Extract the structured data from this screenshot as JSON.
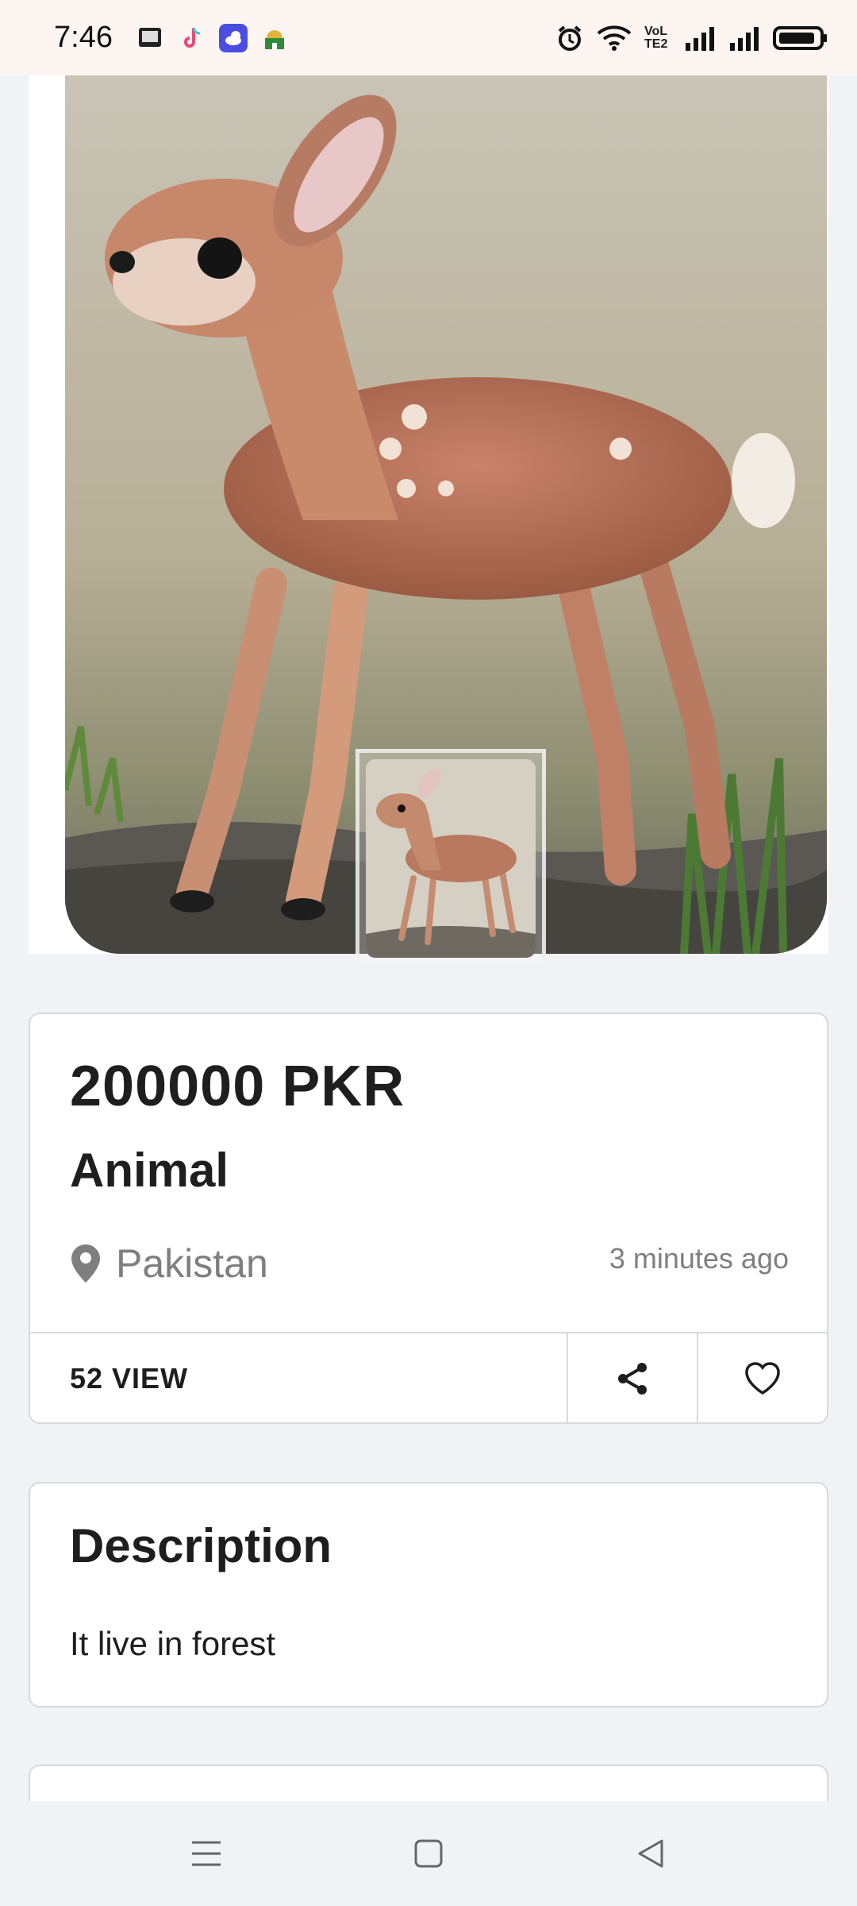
{
  "status_bar": {
    "time": "7:46",
    "apps": [
      "book-app-icon",
      "tiktok-icon",
      "weather-app-icon",
      "mosque-app-icon"
    ],
    "network_label": "VoLTE2",
    "icons": [
      "alarm-icon",
      "wifi-icon",
      "signal-icon",
      "signal-icon",
      "battery-icon"
    ]
  },
  "listing": {
    "price": "200000 PKR",
    "title": "Animal",
    "location": "Pakistan",
    "posted": "3 minutes ago",
    "views": "52 VIEW",
    "photo_subject": "fawn"
  },
  "description": {
    "heading": "Description",
    "text": "It live in forest"
  },
  "nav": {
    "items": [
      "menu-icon",
      "home-icon",
      "back-icon"
    ]
  },
  "colors": {
    "status_bg": "#fcf5f2",
    "page_bg": "#f1f2f6",
    "card_border": "#d8d9de",
    "muted_text": "#7f7f7f",
    "dark_text": "#1e1e1e"
  }
}
